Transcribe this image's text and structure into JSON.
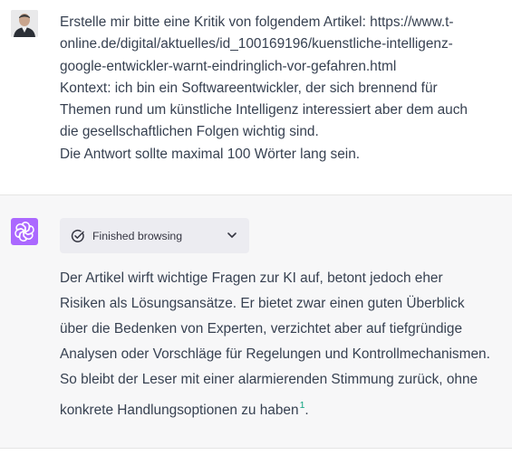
{
  "user_message": {
    "lines": [
      "Erstelle mir bitte eine Kritik von folgendem Artikel: https://www.t-",
      "online.de/digital/aktuelles/id_100169196/kuenstliche-intelligenz-",
      "google-entwickler-warnt-eindringlich-vor-gefahren.html",
      "Kontext: ich bin ein Softwareentwickler, der sich brennend für",
      "Themen rund um künstliche Intelligenz interessiert aber dem auch",
      "die gesellschaftlichen Folgen wichtig sind.",
      "Die Antwort sollte maximal 100 Wörter lang sein."
    ]
  },
  "assistant": {
    "browsing_label": "Finished browsing",
    "answer_lines": [
      "Der Artikel wirft wichtige Fragen zur KI auf, betont jedoch eher",
      "Risiken als Lösungsansätze. Er bietet zwar einen guten Überblick",
      "über die Bedenken von Experten, verzichtet aber auf tiefgründige",
      "Analysen oder Vorschläge für Regelungen und Kontrollmechanismen.",
      "So bleibt der Leser mit einer alarmierenden Stimmung zurück, ohne",
      "konkrete Handlungsoptionen zu haben"
    ],
    "citation": "1",
    "final_period": "."
  },
  "colors": {
    "accent": "#10a37f",
    "assistant_avatar": "#ab68ff",
    "assistant_bg": "#f7f7f8",
    "text": "#374151"
  },
  "icons": {
    "user_avatar": "user-avatar",
    "assistant_avatar": "openai-logo-icon",
    "browsing": "check-circle-icon",
    "expand": "chevron-down-icon"
  }
}
